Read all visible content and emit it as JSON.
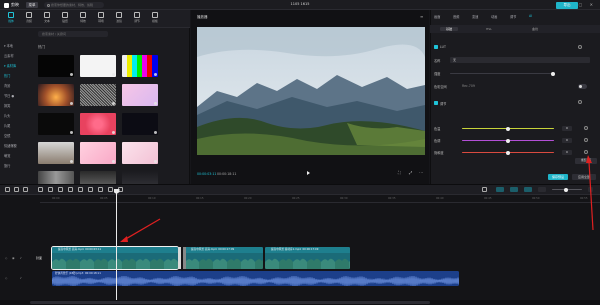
{
  "app": {
    "name": "剪映",
    "menu_label": "菜单",
    "project_title": "1105 1615",
    "search_placeholder": "搜索你想要的素材、特效、剪辑",
    "export_label": "导出",
    "window_controls": "—  ▢  ✕"
  },
  "toolbar": {
    "items": [
      {
        "label": "媒体",
        "icon": "media-icon",
        "active": true
      },
      {
        "label": "音频",
        "icon": "audio-icon"
      },
      {
        "label": "文本",
        "icon": "text-icon"
      },
      {
        "label": "贴纸",
        "icon": "sticker-icon"
      },
      {
        "label": "特效",
        "icon": "effects-icon"
      },
      {
        "label": "转场",
        "icon": "transition-icon"
      },
      {
        "label": "滤镜",
        "icon": "filter-icon"
      },
      {
        "label": "调节",
        "icon": "adjust-icon"
      },
      {
        "label": "模板",
        "icon": "template-icon"
      }
    ]
  },
  "media_sidebar": {
    "items": [
      {
        "label": "▾ 本地",
        "hl": false
      },
      {
        "label": "云素材",
        "hl": false
      },
      {
        "label": "▾ 素材库",
        "hl": true
      },
      {
        "label": "热门",
        "hl": true
      },
      {
        "label": "背景",
        "hl": false
      },
      {
        "label": "节日 ●",
        "hl": false
      },
      {
        "label": "搞笑",
        "hl": false
      },
      {
        "label": "片头",
        "hl": false
      },
      {
        "label": "片尾",
        "hl": false
      },
      {
        "label": "空镜",
        "hl": false
      },
      {
        "label": "情绪爆梗",
        "hl": false
      },
      {
        "label": "萌宠",
        "hl": false
      },
      {
        "label": "旅行",
        "hl": false
      }
    ]
  },
  "media_grid": {
    "search_placeholder": "搜索素材 / 关键词",
    "section": "热门",
    "tiles": [
      "black",
      "white",
      "colorbars",
      "sunset",
      "noise",
      "pink",
      "dark-bar",
      "heart",
      "bluebar",
      "cats",
      "pink2",
      "pink3",
      "faces",
      "screens",
      "cloud"
    ]
  },
  "player": {
    "title": "播放器",
    "timecode": "00:00:03:11",
    "duration": "00:00:18:11",
    "controls": [
      "⛶",
      "⤢",
      "⋯"
    ]
  },
  "inspector": {
    "tabs": [
      "画面",
      "音频",
      "变速",
      "动画",
      "调节",
      "AI"
    ],
    "active_tab": 5,
    "subtabs": [
      "基础",
      "HSL",
      "曲线"
    ],
    "active_subtab": 0,
    "lut_label": "LUT",
    "lut_name_label": "名称",
    "lut_value": "无",
    "color_space_label": "色彩空间",
    "color_space_value": "Rec.709",
    "intensity_label": "强度",
    "adjust_label": "调节",
    "rows": [
      {
        "label": "色温",
        "value": "0",
        "pos": 0.5,
        "color": "#c8d43a"
      },
      {
        "label": "色调",
        "value": "0",
        "pos": 0.5,
        "color": "#b34fd6"
      },
      {
        "label": "饱和度",
        "value": "0",
        "pos": 0.5,
        "color": "#d94a3f"
      }
    ],
    "tooltip": "重置调节",
    "apply_label": "保存预设",
    "apply_all_label": "应用全部"
  },
  "timeline": {
    "ticks": [
      "00:00",
      "00:05",
      "00:10",
      "00:15",
      "00:20",
      "00:25",
      "00:30",
      "00:35",
      "00:40",
      "00:45",
      "00:50",
      "00:55"
    ],
    "track_label": "封面",
    "clips": [
      {
        "name": "提高中风景 高清.mp4",
        "time": "00:00:03:11",
        "selected": true
      },
      {
        "name": "提高中风景 高清.mp4",
        "time": "00:00:17:09",
        "selected": false
      },
      {
        "name": "提高中风景 素材库1.mp4",
        "time": "00:00:17:09",
        "selected": false
      }
    ],
    "audio": {
      "name": "轻快背景乐 (18秒).mp3",
      "time": "00:00:18:11"
    }
  }
}
